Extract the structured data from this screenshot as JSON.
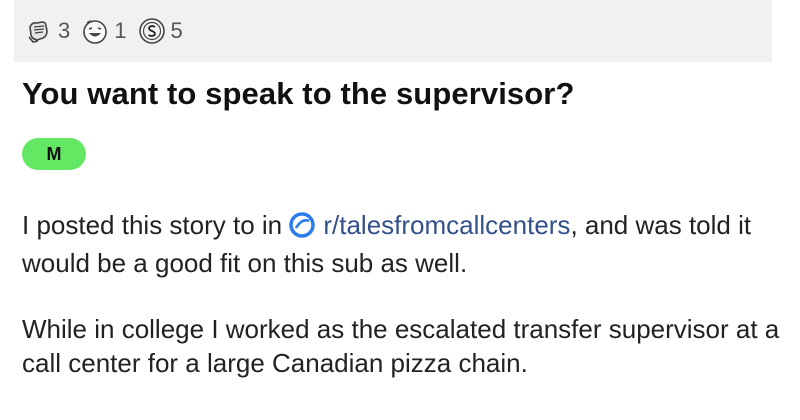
{
  "awards": [
    {
      "icon": "fist-award-icon",
      "count": "3"
    },
    {
      "icon": "laughing-face-award-icon",
      "count": "1"
    },
    {
      "icon": "silver-coin-award-icon",
      "count": "5"
    }
  ],
  "post": {
    "title": "You want to speak to the supervisor?",
    "flair": "M",
    "flair_color": "#64e864",
    "p1_before": "I posted this story to in ",
    "p1_link": "r/talesfromcallcenters",
    "p1_after": ", and was told it would be a good fit on this sub as well.",
    "p2": "While in college I worked as the escalated transfer supervisor at a call center for a large Canadian pizza chain."
  },
  "colors": {
    "link": "#33508a",
    "subreddit_icon": "#2b7de9",
    "awards_bar": "#f1f1f1"
  }
}
